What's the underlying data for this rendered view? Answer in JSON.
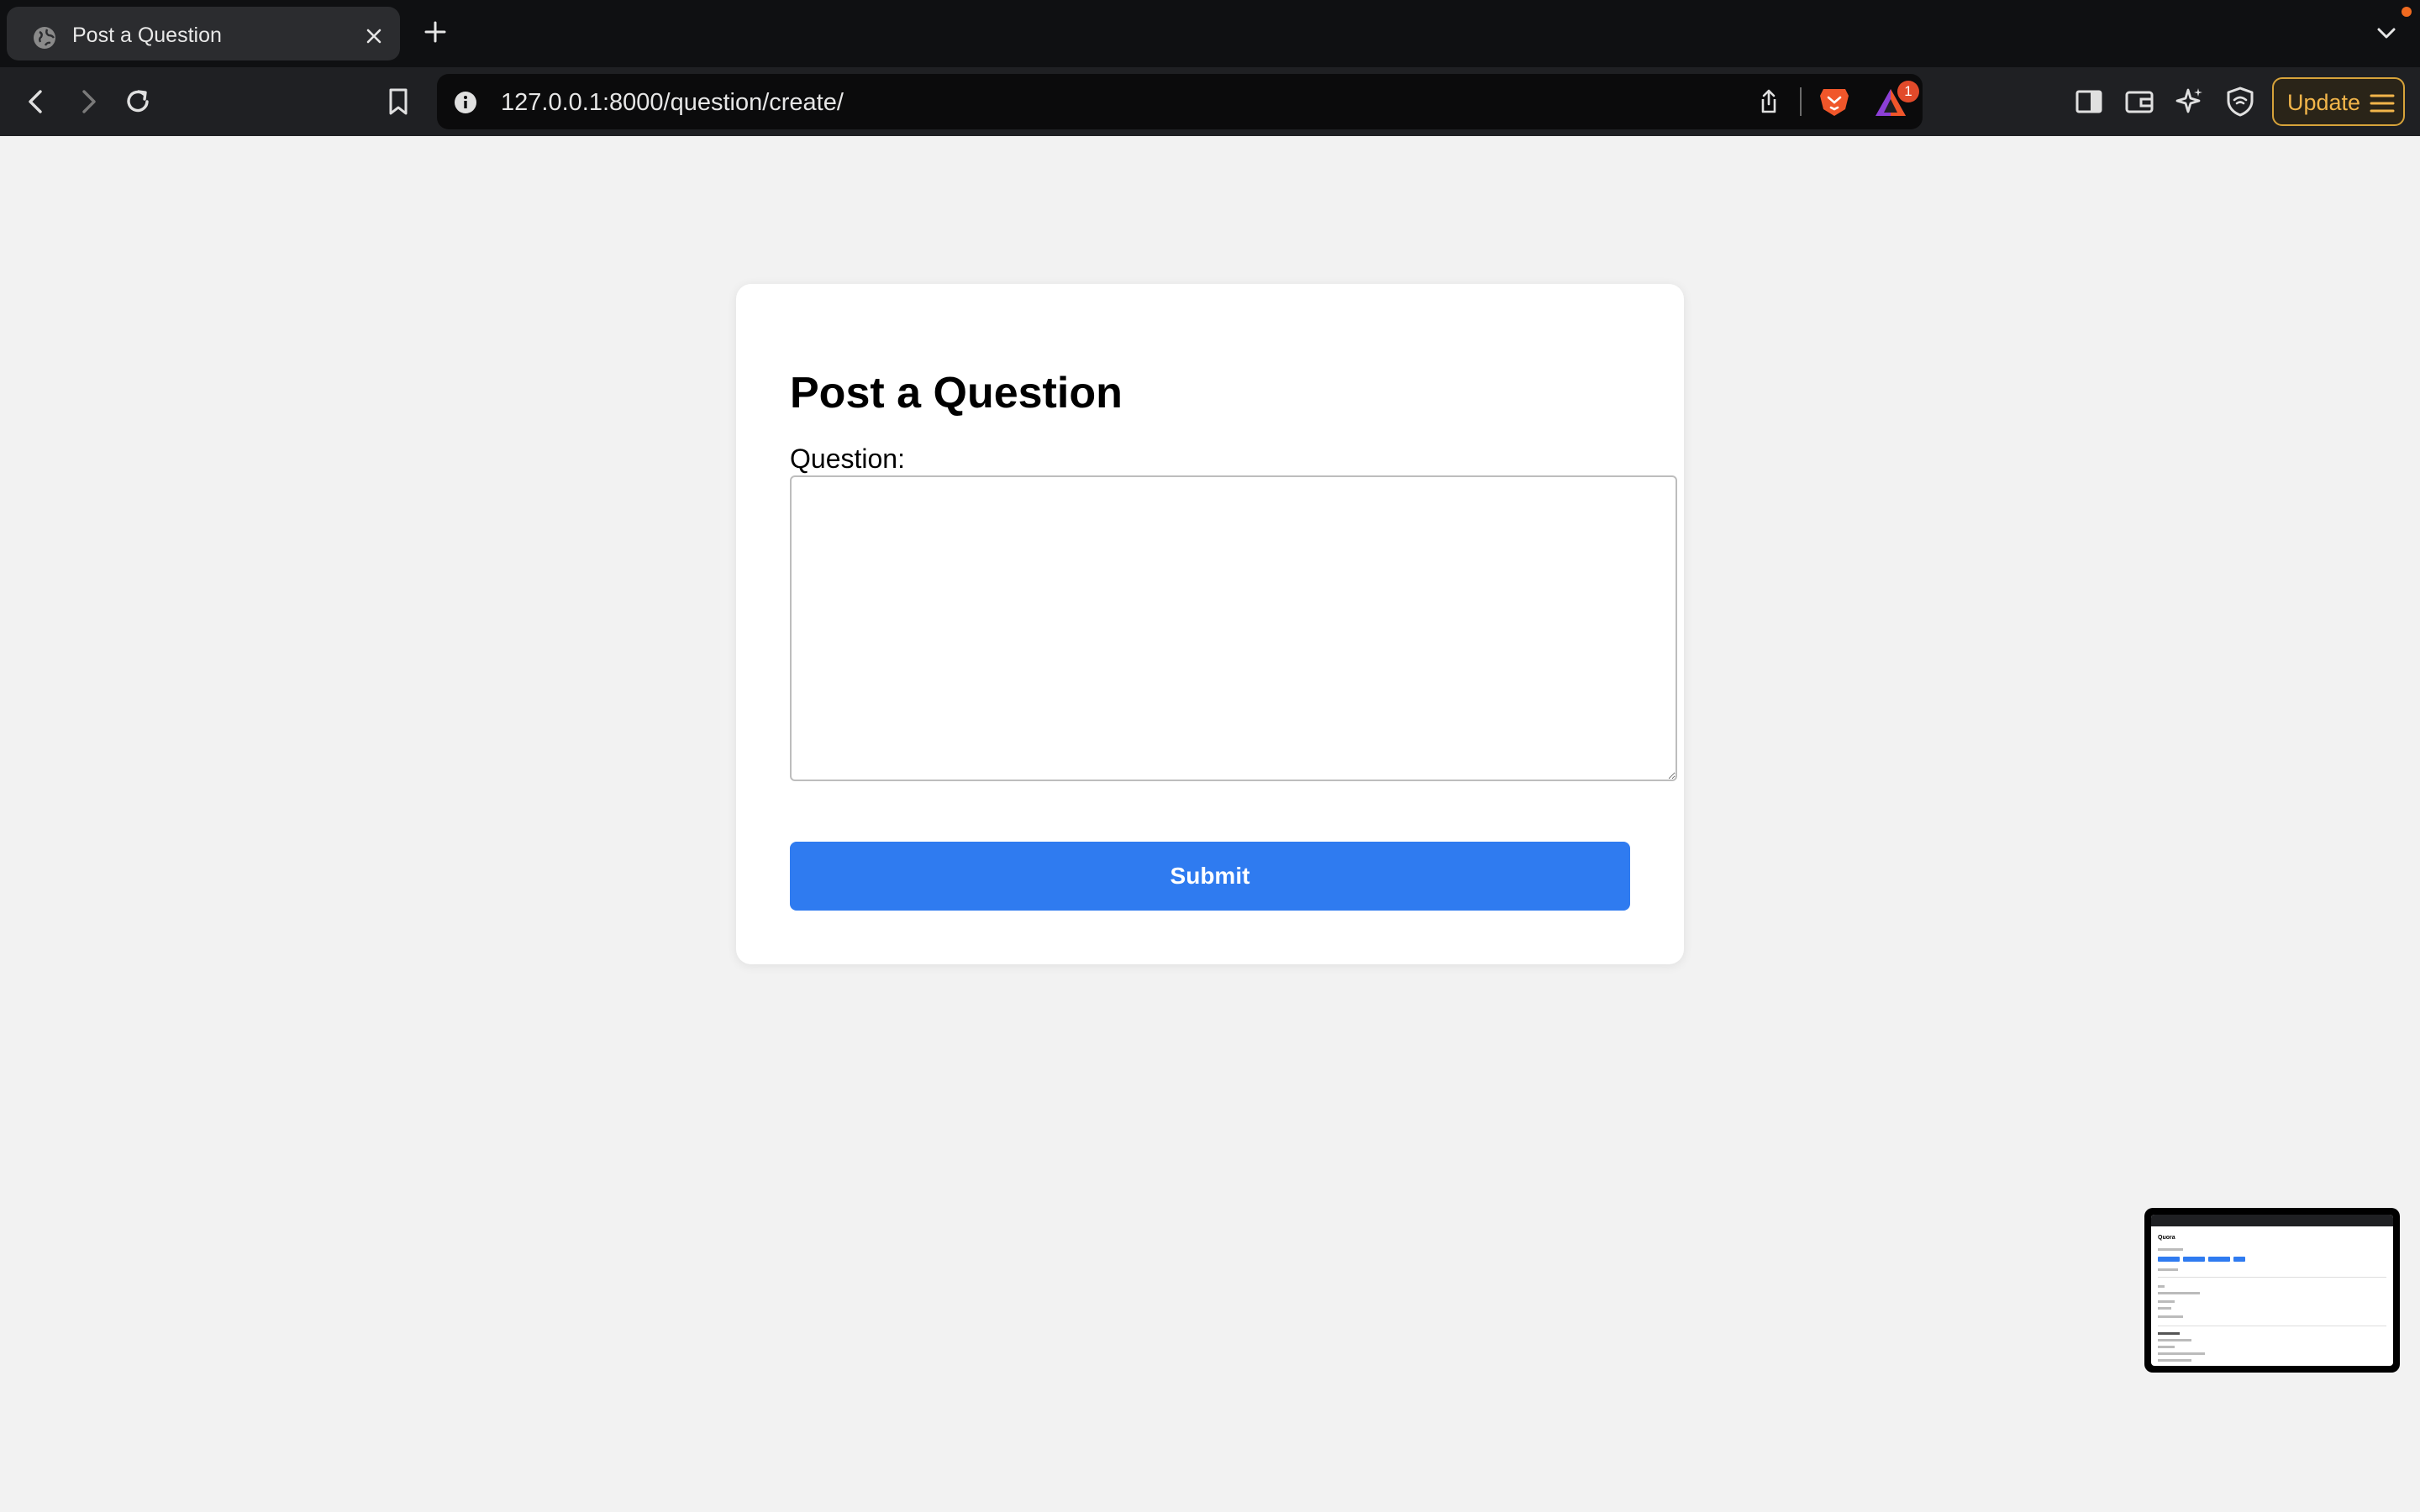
{
  "browser": {
    "tab_title": "Post a Question",
    "url": "127.0.0.1:8000/question/create/",
    "rewards_badge": "1",
    "update_label": "Update"
  },
  "form": {
    "heading": "Post a Question",
    "question_label": "Question:",
    "question_value": "",
    "submit_label": "Submit"
  },
  "thumbnail": {
    "title": "Quora"
  },
  "colors": {
    "accent": "#2f7bf0",
    "page_bg": "#f2f2f2",
    "update_accent": "#f2b54a"
  },
  "icons": [
    "globe-icon",
    "close-icon",
    "plus-icon",
    "chevron-down-icon",
    "back-icon",
    "forward-icon",
    "reload-icon",
    "bookmark-icon",
    "info-icon",
    "share-icon",
    "brave-lion-icon",
    "rewards-triangle-icon",
    "sidebar-icon",
    "wallet-icon",
    "leo-ai-icon",
    "vpn-shield-icon",
    "menu-icon"
  ]
}
